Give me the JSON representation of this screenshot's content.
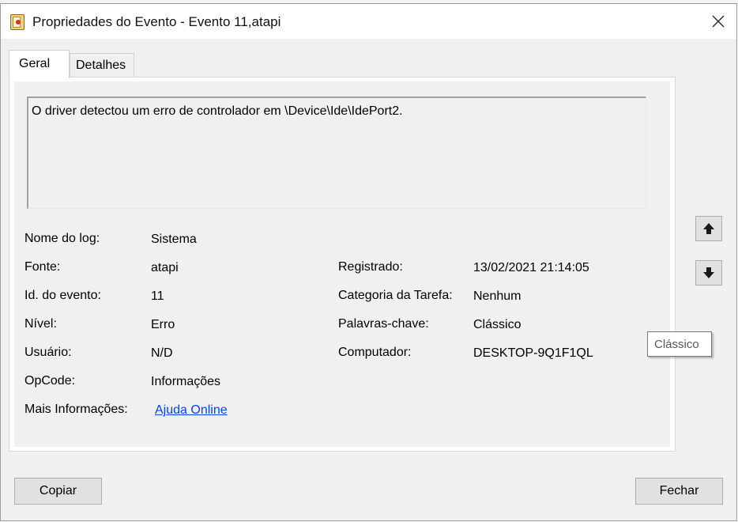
{
  "window": {
    "title": "Propriedades do Evento - Evento 11,atapi"
  },
  "tabs": [
    {
      "label": "Geral"
    },
    {
      "label": "Detalhes"
    }
  ],
  "description": "O driver detectou um erro de controlador em \\Device\\Ide\\IdePort2.",
  "fields": {
    "log_name": {
      "label": "Nome do log:",
      "value": "Sistema"
    },
    "source": {
      "label": "Fonte:",
      "value": "atapi"
    },
    "event_id": {
      "label": "Id. do evento:",
      "value": "11"
    },
    "level": {
      "label": "Nível:",
      "value": "Erro"
    },
    "user": {
      "label": "Usuário:",
      "value": "N/D"
    },
    "opcode": {
      "label": "OpCode:",
      "value": "Informações"
    },
    "more_info": {
      "label": "Mais Informações:",
      "value": "Ajuda Online"
    },
    "logged": {
      "label": "Registrado:",
      "value": "13/02/2021 21:14:05"
    },
    "task_category": {
      "label": "Categoria da Tarefa:",
      "value": "Nenhum"
    },
    "keywords": {
      "label": "Palavras-chave:",
      "value": "Clássico"
    },
    "computer": {
      "label": "Computador:",
      "value": "DESKTOP-9Q1F1QL"
    }
  },
  "tooltip": "Clássico",
  "buttons": {
    "copy": "Copiar",
    "close": "Fechar"
  },
  "icons": {
    "up": "arrow-up-icon",
    "down": "arrow-down-icon",
    "close": "close-icon",
    "app": "event-viewer-icon"
  }
}
